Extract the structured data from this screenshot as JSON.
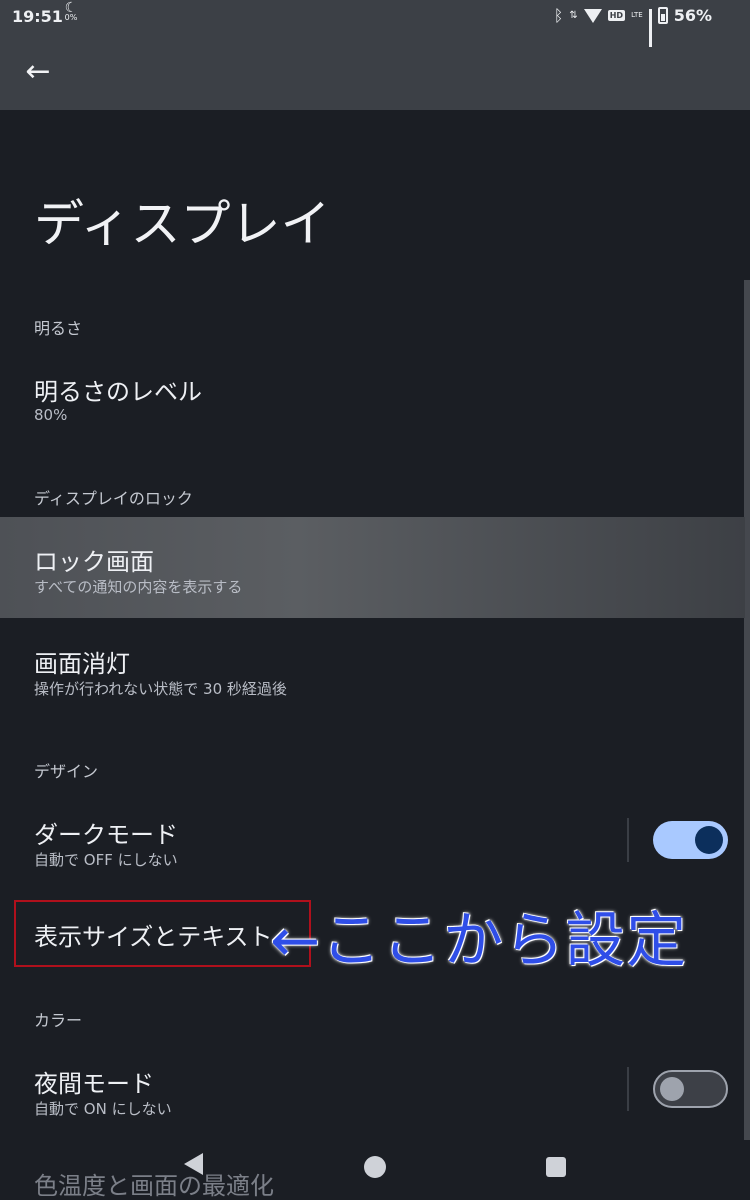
{
  "status_bar": {
    "time": "19:51",
    "download_percent": "0%",
    "lte_label": "LTE",
    "hd_label": "HD",
    "battery": "56%"
  },
  "page": {
    "title": "ディスプレイ"
  },
  "sections": {
    "brightness": {
      "header": "明るさ",
      "brightness_level": {
        "title": "明るさのレベル",
        "value": "80%"
      }
    },
    "lock": {
      "header": "ディスプレイのロック",
      "lock_screen": {
        "title": "ロック画面",
        "subtitle": "すべての通知の内容を表示する"
      },
      "screen_timeout": {
        "title": "画面消灯",
        "subtitle": "操作が行われない状態で 30 秒経過後"
      }
    },
    "design": {
      "header": "デザイン",
      "dark_mode": {
        "title": "ダークモード",
        "subtitle": "自動で OFF にしない",
        "enabled": true
      },
      "display_size": {
        "title": "表示サイズとテキスト"
      }
    },
    "color": {
      "header": "カラー",
      "night_mode": {
        "title": "夜間モード",
        "subtitle": "自動で ON にしない",
        "enabled": false
      },
      "color_temperature": {
        "title": "色温度と画面の最適化"
      }
    }
  },
  "annotation": {
    "text": "←ここから設定",
    "color": "#2f4ee8",
    "box_color": "#b0101c"
  },
  "colors": {
    "background": "#1b1e24",
    "toolbar": "#3c4046",
    "toggle_on": "#a9c9ff"
  }
}
